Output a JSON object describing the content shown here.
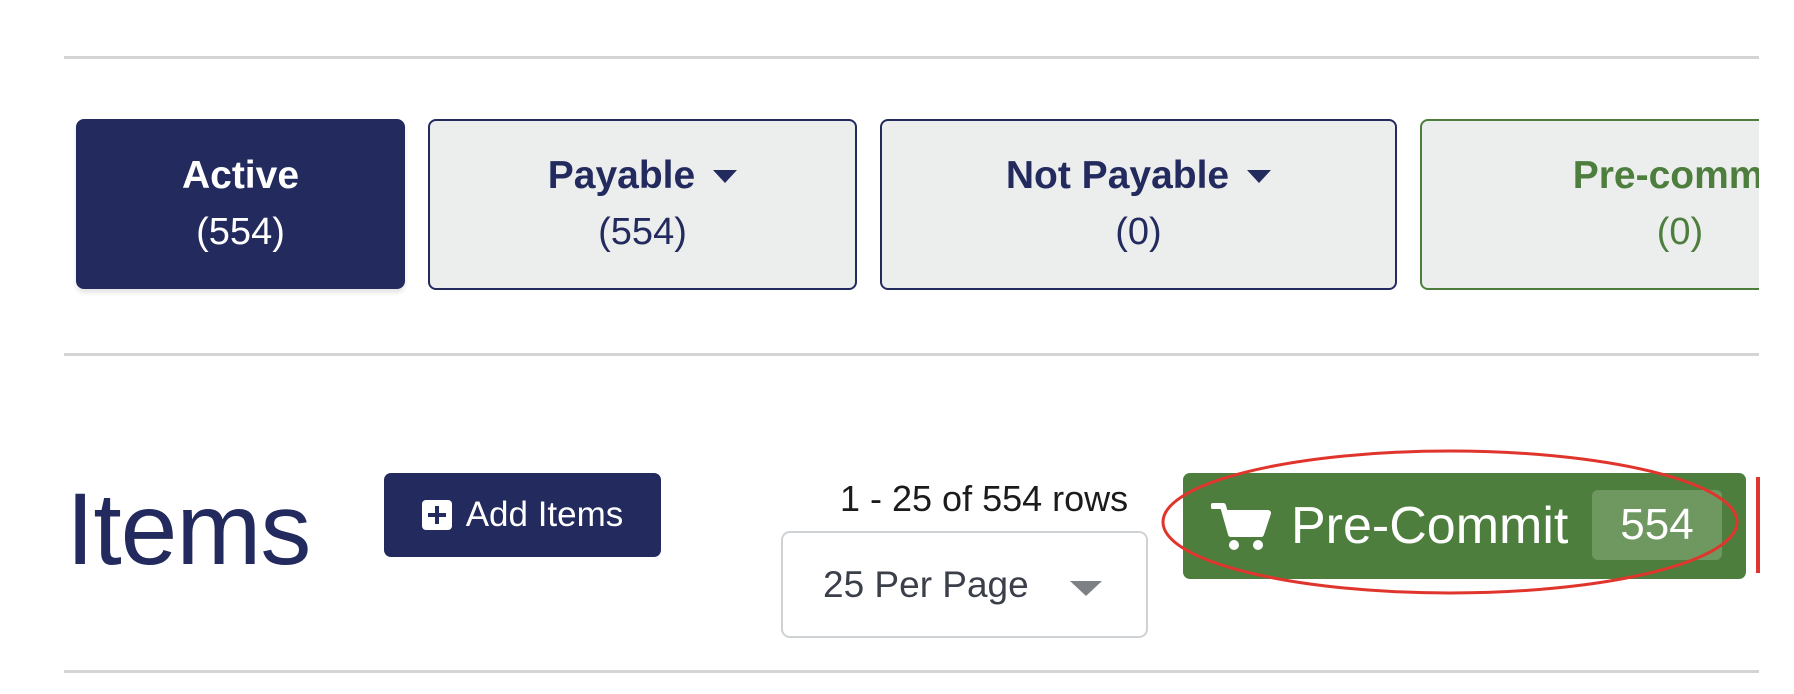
{
  "filters": [
    {
      "label": "Active",
      "count": "(554)"
    },
    {
      "label": "Payable",
      "count": "(554)"
    },
    {
      "label": "Not Payable",
      "count": "(0)"
    },
    {
      "label": "Pre-commit",
      "count": "(0)"
    }
  ],
  "items_section": {
    "title": "Items",
    "add_button_label": "Add Items",
    "rows_summary": "1 - 25 of 554 rows",
    "per_page_value": "25 Per Page",
    "precommit_button_label": "Pre-Commit",
    "precommit_count": "554"
  },
  "icons": {
    "add": "plus-square-icon",
    "precommit": "shopping-cart-icon",
    "dropdown": "caret-down-icon"
  },
  "colors": {
    "navy": "#232a5e",
    "green": "#4d7e3e",
    "highlight": "#e0352c"
  }
}
